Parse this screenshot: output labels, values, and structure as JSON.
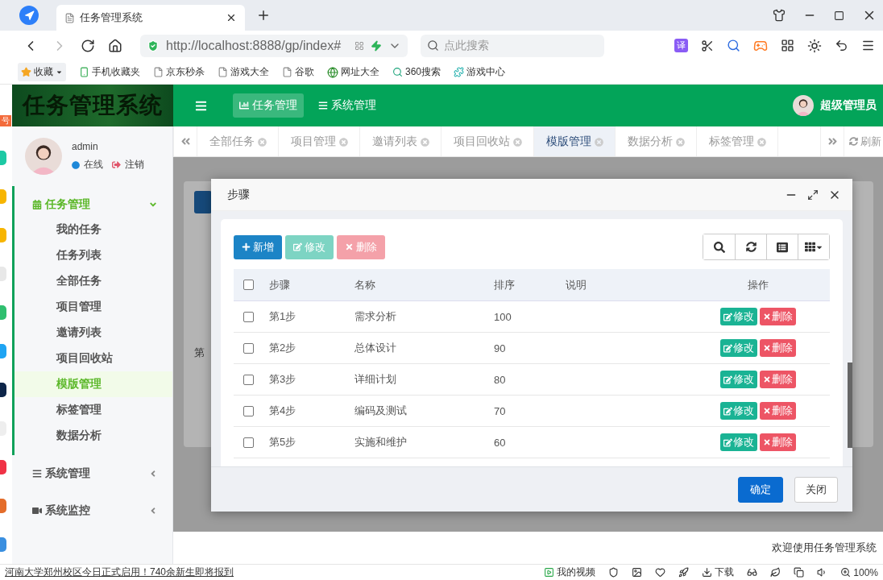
{
  "browser": {
    "side_badge": "号",
    "tab_title": "任务管理系统",
    "url": "http://localhost:8888/gp/index#",
    "search_placeholder": "点此搜索",
    "translate_label": "译",
    "bookmarks": [
      {
        "label": "收藏",
        "kind": "star"
      },
      {
        "label": "手机收藏夹",
        "kind": "phone"
      },
      {
        "label": "京东秒杀",
        "kind": "page"
      },
      {
        "label": "游戏大全",
        "kind": "page"
      },
      {
        "label": "谷歌",
        "kind": "page"
      },
      {
        "label": "网址大全",
        "kind": "globe"
      },
      {
        "label": "360搜索",
        "kind": "search"
      },
      {
        "label": "游戏中心",
        "kind": "puzzle"
      }
    ],
    "status_bar": {
      "news": "河南大学郑州校区今日正式启用！740余新生即将报到",
      "video": "我的视频",
      "download": "下载",
      "zoom": "100%"
    }
  },
  "app": {
    "logo": "任务管理系统",
    "nav": [
      {
        "label": "任务管理",
        "kind": "chart",
        "selected": true
      },
      {
        "label": "系统管理",
        "kind": "list",
        "selected": false
      }
    ],
    "user_name": "超级管理员",
    "sidebar": {
      "user": "admin",
      "status": "在线",
      "logout": "注销",
      "groups": [
        {
          "label": "任务管理",
          "kind": "calendar",
          "expanded": true,
          "children": [
            {
              "label": "我的任务",
              "selected": false
            },
            {
              "label": "任务列表",
              "selected": false
            },
            {
              "label": "全部任务",
              "selected": false
            },
            {
              "label": "项目管理",
              "selected": false
            },
            {
              "label": "邀请列表",
              "selected": false
            },
            {
              "label": "项目回收站",
              "selected": false
            },
            {
              "label": "模版管理",
              "selected": true
            },
            {
              "label": "标签管理",
              "selected": false
            },
            {
              "label": "数据分析",
              "selected": false
            }
          ]
        },
        {
          "label": "系统管理",
          "kind": "list",
          "expanded": false
        },
        {
          "label": "系统监控",
          "kind": "video",
          "expanded": false
        }
      ]
    },
    "tabs": [
      {
        "label": "全部任务",
        "selected": false
      },
      {
        "label": "项目管理",
        "selected": false
      },
      {
        "label": "邀请列表",
        "selected": false
      },
      {
        "label": "项目回收站",
        "selected": false
      },
      {
        "label": "模版管理",
        "selected": true
      },
      {
        "label": "数据分析",
        "selected": false
      },
      {
        "label": "标签管理",
        "selected": false
      }
    ],
    "refresh": "刷新",
    "background_text": "第",
    "footer": "欢迎使用任务管理系统"
  },
  "dialog": {
    "title": "步骤",
    "toolbar": [
      {
        "label": "新增",
        "kind": "add",
        "disabled": false
      },
      {
        "label": "修改",
        "kind": "edit",
        "disabled": true
      },
      {
        "label": "删除",
        "kind": "delete",
        "disabled": true
      }
    ],
    "header_checked": false,
    "columns": [
      "步骤",
      "名称",
      "排序",
      "说明",
      "操作"
    ],
    "rows": [
      {
        "step": "第1步",
        "name": "需求分析",
        "order": "100",
        "checked": false,
        "actions": [
          "修改",
          "删除"
        ]
      },
      {
        "step": "第2步",
        "name": "总体设计",
        "order": "90",
        "checked": false,
        "actions": [
          "修改",
          "删除"
        ]
      },
      {
        "step": "第3步",
        "name": "详细计划",
        "order": "80",
        "checked": false,
        "actions": [
          "修改",
          "删除"
        ]
      },
      {
        "step": "第4步",
        "name": "编码及测试",
        "order": "70",
        "checked": false,
        "actions": [
          "修改",
          "删除"
        ]
      },
      {
        "step": "第5步",
        "name": "实施和维护",
        "order": "60",
        "checked": false,
        "actions": [
          "修改",
          "删除"
        ]
      }
    ],
    "buttons": [
      {
        "label": "确定",
        "kind": "primary"
      },
      {
        "label": "关闭",
        "kind": "default"
      }
    ]
  }
}
